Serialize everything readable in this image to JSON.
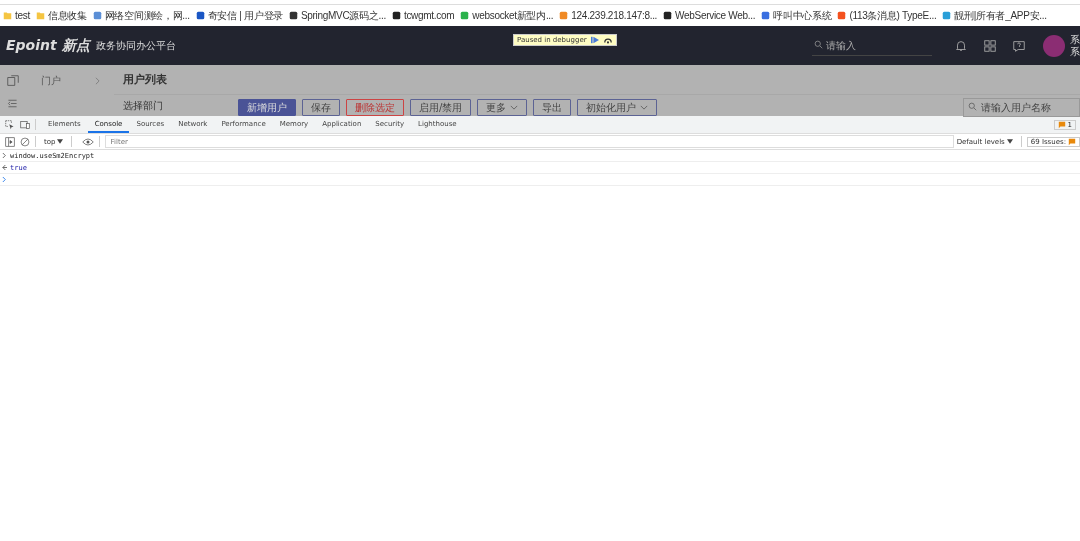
{
  "bookmarks": [
    {
      "label": "test",
      "kind": "folder",
      "color": "#f5c542"
    },
    {
      "label": "信息收集",
      "kind": "folder",
      "color": "#f5c542"
    },
    {
      "label": "网络空间测绘，网...",
      "kind": "site",
      "color": "#5b8fd6"
    },
    {
      "label": "奇安信 | 用户登录",
      "kind": "site",
      "color": "#1a56c4"
    },
    {
      "label": "SpringMVC源码之...",
      "kind": "site",
      "color": "#333333"
    },
    {
      "label": "tcwgmt.com",
      "kind": "site",
      "color": "#222222"
    },
    {
      "label": "websocket新型内...",
      "kind": "site",
      "color": "#2bb24c"
    },
    {
      "label": "124.239.218.147:8...",
      "kind": "site",
      "color": "#f08a24"
    },
    {
      "label": "WebService Web...",
      "kind": "site",
      "color": "#222222"
    },
    {
      "label": "呼叫中心系统",
      "kind": "site",
      "color": "#3a6fe0"
    },
    {
      "label": "(113条消息) TypeE...",
      "kind": "site",
      "color": "#f4511e"
    },
    {
      "label": "靓刑|所有者_APP安...",
      "kind": "site",
      "color": "#2a9fd8"
    }
  ],
  "header": {
    "logo": "Epoint 新点",
    "subtitle": "政务协同办公平台",
    "search": {
      "placeholder": "请输入"
    },
    "user_line_1": "系",
    "user_line_2": "系"
  },
  "debugger_banner": {
    "text": "Paused in debugger"
  },
  "sidebar": {
    "items": [
      {
        "label": "门户",
        "kind": "portal"
      }
    ]
  },
  "page": {
    "title": "用户列表",
    "dept_label": "选择部门",
    "buttons": [
      {
        "label": "新增用户",
        "kind": "primary"
      },
      {
        "label": "保存",
        "kind": "default"
      },
      {
        "label": "删除选定",
        "kind": "danger"
      },
      {
        "label": "启用/禁用",
        "kind": "default"
      },
      {
        "label": "更多",
        "kind": "dropdown"
      },
      {
        "label": "导出",
        "kind": "default"
      },
      {
        "label": "初始化用户",
        "kind": "dropdown"
      }
    ],
    "search": {
      "placeholder": "请输入用户名称"
    }
  },
  "devtools": {
    "tabs": [
      {
        "label": "Elements",
        "selected": false
      },
      {
        "label": "Console",
        "selected": true
      },
      {
        "label": "Sources",
        "selected": false
      },
      {
        "label": "Network",
        "selected": false
      },
      {
        "label": "Performance",
        "selected": false
      },
      {
        "label": "Memory",
        "selected": false
      },
      {
        "label": "Application",
        "selected": false
      },
      {
        "label": "Security",
        "selected": false
      },
      {
        "label": "Lighthouse",
        "selected": false
      }
    ],
    "issues_badge": "1",
    "context": "top",
    "filter": {
      "placeholder": "Filter"
    },
    "levels": "Default levels",
    "issues": "69 Issues:",
    "console": [
      {
        "kind": "input",
        "text": "window.useSm2Encrypt"
      },
      {
        "kind": "output",
        "text": "true"
      },
      {
        "kind": "prompt"
      }
    ]
  }
}
